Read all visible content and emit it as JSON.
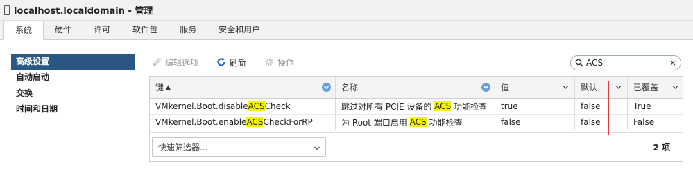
{
  "window": {
    "title": "localhost.localdomain - 管理"
  },
  "tabs": [
    {
      "label": "系统",
      "active": true
    },
    {
      "label": "硬件"
    },
    {
      "label": "许可"
    },
    {
      "label": "软件包"
    },
    {
      "label": "服务"
    },
    {
      "label": "安全和用户"
    }
  ],
  "sidebar": {
    "items": [
      {
        "label": "高级设置",
        "active": true
      },
      {
        "label": "自动启动"
      },
      {
        "label": "交换"
      },
      {
        "label": "时间和日期"
      }
    ]
  },
  "toolbar": {
    "edit_label": "编辑选项",
    "refresh_label": "刷新",
    "actions_label": "操作"
  },
  "search": {
    "value": "ACS",
    "clear_icon": "×"
  },
  "grid": {
    "columns": [
      {
        "label": "键",
        "sort": "▲"
      },
      {
        "label": "名称"
      },
      {
        "label": "值"
      },
      {
        "label": "默认"
      },
      {
        "label": "已覆盖"
      }
    ],
    "rows": [
      {
        "key_pre": "VMkernel.Boot.disable",
        "key_hl": "ACS",
        "key_post": "Check",
        "name_pre": "跳过对所有 PCIE 设备的 ",
        "name_hl": "ACS",
        "name_post": " 功能检查",
        "value": "true",
        "default": "false",
        "overridden": "True"
      },
      {
        "key_pre": "VMkernel.Boot.enable",
        "key_hl": "ACS",
        "key_post": "CheckForRP",
        "name_pre": "为 Root 端口启用 ",
        "name_hl": "ACS",
        "name_post": " 功能检查",
        "value": "false",
        "default": "false",
        "overridden": "False"
      }
    ],
    "filter_placeholder": "快速筛选器...",
    "count": "2 项"
  },
  "colors": {
    "accent": "#2b5784",
    "highlight": "#f5f500",
    "annotation": "#e03c3c"
  }
}
